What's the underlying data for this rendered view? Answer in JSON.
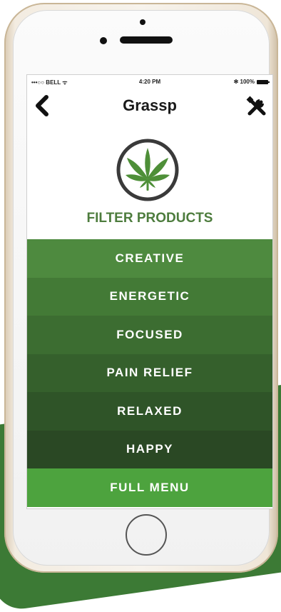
{
  "status_bar": {
    "carrier": "•••○○ BELL ᯤ",
    "time": "4:20 PM",
    "battery": "✻ 100%"
  },
  "nav": {
    "title": "Grassp",
    "back_icon": "chevron-left-icon",
    "tools_icon": "wrench-screwdriver-icon"
  },
  "logo": {
    "icon": "cannabis-leaf-icon"
  },
  "heading": "FILTER PRODUCTS",
  "menu": {
    "items": [
      {
        "label": "CREATIVE",
        "color": "#4e8a3f"
      },
      {
        "label": "ENERGETIC",
        "color": "#437a36"
      },
      {
        "label": "FOCUSED",
        "color": "#3c6d31"
      },
      {
        "label": "PAIN RELIEF",
        "color": "#35602c"
      },
      {
        "label": "RELAXED",
        "color": "#2f5428"
      },
      {
        "label": "HAPPY",
        "color": "#2a4824"
      }
    ],
    "full_menu": {
      "label": "FULL MENU",
      "color": "#4da33e"
    }
  },
  "colors": {
    "brand_green": "#4d7c3d",
    "logo_ring": "#3a3a3a"
  }
}
